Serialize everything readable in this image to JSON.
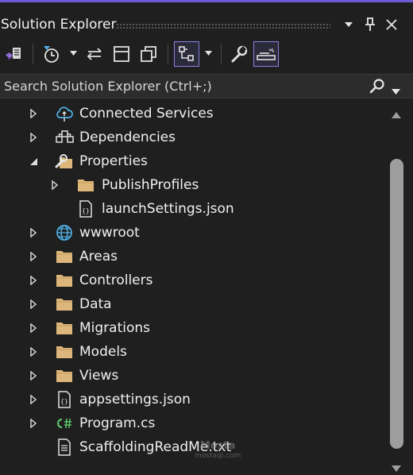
{
  "panel": {
    "title": "Solution Explorer"
  },
  "search": {
    "placeholder": "Search Solution Explorer (Ctrl+;)"
  },
  "toolbar": {
    "buttons": [
      "vs-solution-icon",
      "history-icon",
      "sync-arrows-icon",
      "collapse-all-icon",
      "show-all-files-icon",
      "hierarchy-icon",
      "wrench-icon",
      "preview-icon"
    ]
  },
  "tree": {
    "items": [
      {
        "label": "Connected Services",
        "icon": "connected-services-icon",
        "expander": "collapsed"
      },
      {
        "label": "Dependencies",
        "icon": "dependencies-icon",
        "expander": "collapsed"
      },
      {
        "label": "Properties",
        "icon": "properties-icon",
        "expander": "expanded"
      },
      {
        "label": "PublishProfiles",
        "icon": "folder-icon",
        "expander": "collapsed"
      },
      {
        "label": "launchSettings.json",
        "icon": "json-file-icon",
        "expander": "none"
      },
      {
        "label": "wwwroot",
        "icon": "globe-icon",
        "expander": "collapsed"
      },
      {
        "label": "Areas",
        "icon": "folder-icon",
        "expander": "collapsed"
      },
      {
        "label": "Controllers",
        "icon": "folder-icon",
        "expander": "collapsed"
      },
      {
        "label": "Data",
        "icon": "folder-icon",
        "expander": "collapsed"
      },
      {
        "label": "Migrations",
        "icon": "folder-icon",
        "expander": "collapsed"
      },
      {
        "label": "Models",
        "icon": "folder-icon",
        "expander": "collapsed"
      },
      {
        "label": "Views",
        "icon": "folder-icon",
        "expander": "collapsed"
      },
      {
        "label": "appsettings.json",
        "icon": "json-file-icon",
        "expander": "collapsed"
      },
      {
        "label": "Program.cs",
        "icon": "csharp-file-icon",
        "expander": "collapsed"
      },
      {
        "label": "ScaffoldingReadMe.txt",
        "icon": "text-file-icon",
        "expander": "none"
      }
    ]
  },
  "watermark": {
    "line1": "Mosta",
    "line2": "mostaql.com"
  },
  "colors": {
    "background": "#1f1f1f",
    "accent": "#8a7fe0",
    "folder": "#dcb67a",
    "link": "#4fb0e8",
    "csharp": "#5cc26a"
  }
}
